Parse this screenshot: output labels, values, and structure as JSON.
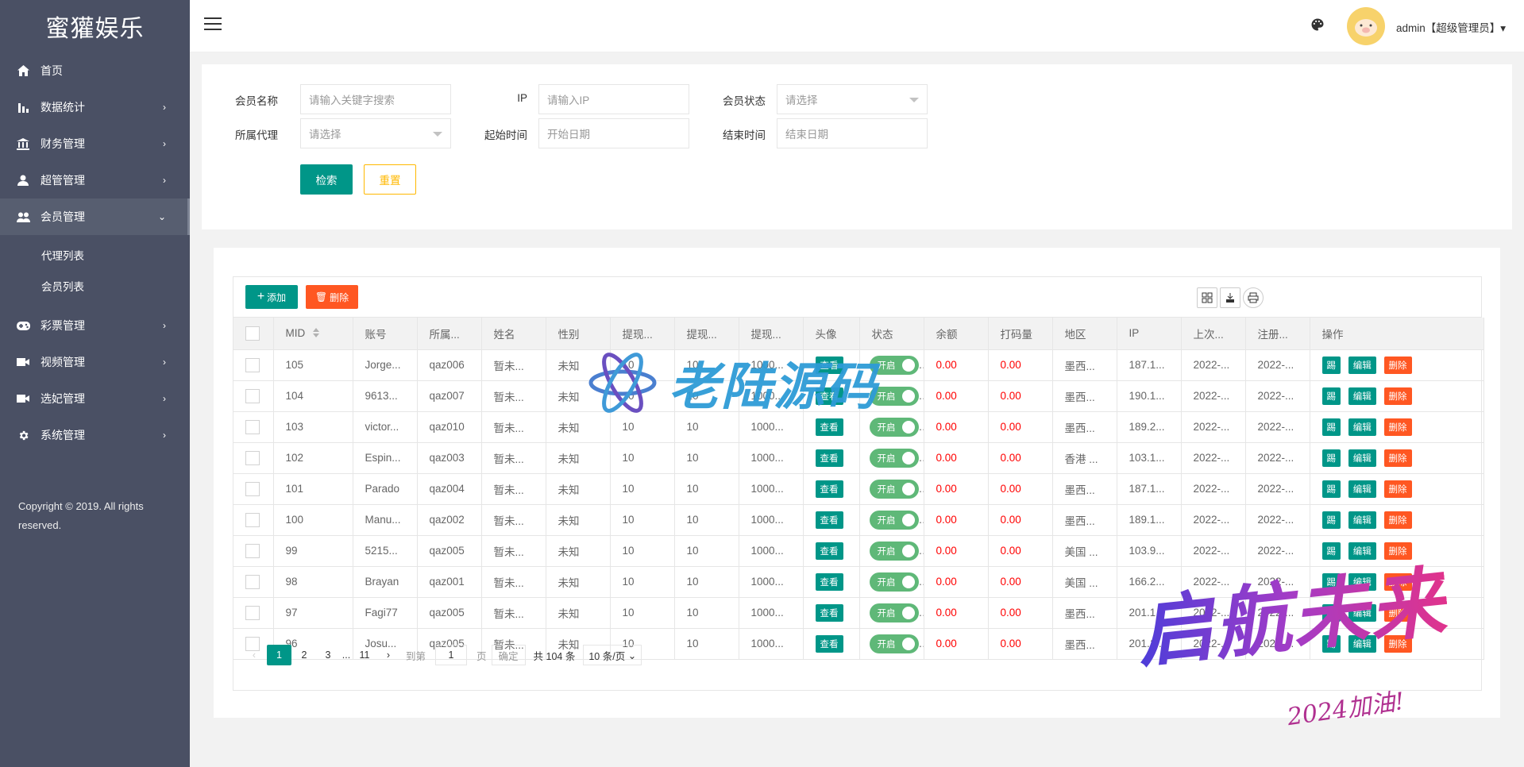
{
  "sidebar": {
    "logo": "蜜獾娱乐",
    "items": [
      {
        "label": "首页",
        "icon": "home-icon",
        "arrow": ""
      },
      {
        "label": "数据统计",
        "icon": "bar-chart-icon",
        "arrow": "›"
      },
      {
        "label": "财务管理",
        "icon": "bank-icon",
        "arrow": "›"
      },
      {
        "label": "超管管理",
        "icon": "user-icon",
        "arrow": "›"
      },
      {
        "label": "会员管理",
        "icon": "users-icon",
        "arrow": "⌄"
      },
      {
        "label": "彩票管理",
        "icon": "gamepad-icon",
        "arrow": "›"
      },
      {
        "label": "视频管理",
        "icon": "video-icon",
        "arrow": "›"
      },
      {
        "label": "选妃管理",
        "icon": "video-icon",
        "arrow": "›"
      },
      {
        "label": "系统管理",
        "icon": "gear-icon",
        "arrow": "›"
      }
    ],
    "sub_items": [
      "代理列表",
      "会员列表"
    ],
    "copyright": "Copyright © 2019. All rights reserved."
  },
  "header": {
    "user": "admin【超级管理员】▾"
  },
  "search": {
    "member_name_label": "会员名称",
    "member_name_placeholder": "请输入关键字搜索",
    "ip_label": "IP",
    "ip_placeholder": "请输入IP",
    "status_label": "会员状态",
    "status_placeholder": "请选择",
    "agent_label": "所属代理",
    "agent_placeholder": "请选择",
    "start_label": "起始时间",
    "start_placeholder": "开始日期",
    "end_label": "结束时间",
    "end_placeholder": "结束日期",
    "search_btn": "检索",
    "reset_btn": "重置"
  },
  "toolbar": {
    "add_label": "添加",
    "delete_label": "删除"
  },
  "table": {
    "headers": [
      "MID",
      "账号",
      "所属...",
      "姓名",
      "性别",
      "提现...",
      "提现...",
      "提现...",
      "头像",
      "状态",
      "余额",
      "打码量",
      "地区",
      "IP",
      "上次...",
      "注册...",
      "操作"
    ],
    "view_label": "查看",
    "switch_label": "开启",
    "action_labels": [
      "踢",
      "编辑",
      "删除"
    ],
    "rows": [
      {
        "mid": "105",
        "account": "Jorge...",
        "agent": "qaz006",
        "name": "暂未...",
        "gender": "未知",
        "w1": "10",
        "w2": "10",
        "w3": "1000...",
        "balance": "0.00",
        "code": "0.00",
        "region": "墨西...",
        "ip": "187.1...",
        "last": "2022-...",
        "reg": "2022-..."
      },
      {
        "mid": "104",
        "account": "9613...",
        "agent": "qaz007",
        "name": "暂未...",
        "gender": "未知",
        "w1": "10",
        "w2": "10",
        "w3": "1000...",
        "balance": "0.00",
        "code": "0.00",
        "region": "墨西...",
        "ip": "190.1...",
        "last": "2022-...",
        "reg": "2022-..."
      },
      {
        "mid": "103",
        "account": "victor...",
        "agent": "qaz010",
        "name": "暂未...",
        "gender": "未知",
        "w1": "10",
        "w2": "10",
        "w3": "1000...",
        "balance": "0.00",
        "code": "0.00",
        "region": "墨西...",
        "ip": "189.2...",
        "last": "2022-...",
        "reg": "2022-..."
      },
      {
        "mid": "102",
        "account": "Espin...",
        "agent": "qaz003",
        "name": "暂未...",
        "gender": "未知",
        "w1": "10",
        "w2": "10",
        "w3": "1000...",
        "balance": "0.00",
        "code": "0.00",
        "region": "香港 ...",
        "ip": "103.1...",
        "last": "2022-...",
        "reg": "2022-..."
      },
      {
        "mid": "101",
        "account": "Parado",
        "agent": "qaz004",
        "name": "暂未...",
        "gender": "未知",
        "w1": "10",
        "w2": "10",
        "w3": "1000...",
        "balance": "0.00",
        "code": "0.00",
        "region": "墨西...",
        "ip": "187.1...",
        "last": "2022-...",
        "reg": "2022-..."
      },
      {
        "mid": "100",
        "account": "Manu...",
        "agent": "qaz002",
        "name": "暂未...",
        "gender": "未知",
        "w1": "10",
        "w2": "10",
        "w3": "1000...",
        "balance": "0.00",
        "code": "0.00",
        "region": "墨西...",
        "ip": "189.1...",
        "last": "2022-...",
        "reg": "2022-..."
      },
      {
        "mid": "99",
        "account": "5215...",
        "agent": "qaz005",
        "name": "暂未...",
        "gender": "未知",
        "w1": "10",
        "w2": "10",
        "w3": "1000...",
        "balance": "0.00",
        "code": "0.00",
        "region": "美国 ...",
        "ip": "103.9...",
        "last": "2022-...",
        "reg": "2022-..."
      },
      {
        "mid": "98",
        "account": "Brayan",
        "agent": "qaz001",
        "name": "暂未...",
        "gender": "未知",
        "w1": "10",
        "w2": "10",
        "w3": "1000...",
        "balance": "0.00",
        "code": "0.00",
        "region": "美国 ...",
        "ip": "166.2...",
        "last": "2022-...",
        "reg": "2022-..."
      },
      {
        "mid": "97",
        "account": "Fagi77",
        "agent": "qaz005",
        "name": "暂未...",
        "gender": "未知",
        "w1": "10",
        "w2": "10",
        "w3": "1000...",
        "balance": "0.00",
        "code": "0.00",
        "region": "墨西...",
        "ip": "201.1...",
        "last": "2022-...",
        "reg": "2022-..."
      },
      {
        "mid": "96",
        "account": "Josu...",
        "agent": "qaz005",
        "name": "暂未...",
        "gender": "未知",
        "w1": "10",
        "w2": "10",
        "w3": "1000...",
        "balance": "0.00",
        "code": "0.00",
        "region": "墨西...",
        "ip": "201.1...",
        "last": "2022-...",
        "reg": "2022-..."
      }
    ]
  },
  "pagination": {
    "pages": [
      "1",
      "2",
      "3",
      "...",
      "11"
    ],
    "goto_label": "到第",
    "goto_value": "1",
    "page_unit": "页",
    "confirm_label": "确定",
    "total_label": "共 104 条",
    "per_page": "10 条/页"
  },
  "watermarks": {
    "center": "老陆源码",
    "corner_main": "启航未来",
    "corner_sub": "2024加油!"
  },
  "colors": {
    "sidebar_bg": "#4a5064",
    "primary": "#009688",
    "danger": "#ff5722",
    "warning": "#ffb800",
    "switch_on": "#5fb878"
  }
}
